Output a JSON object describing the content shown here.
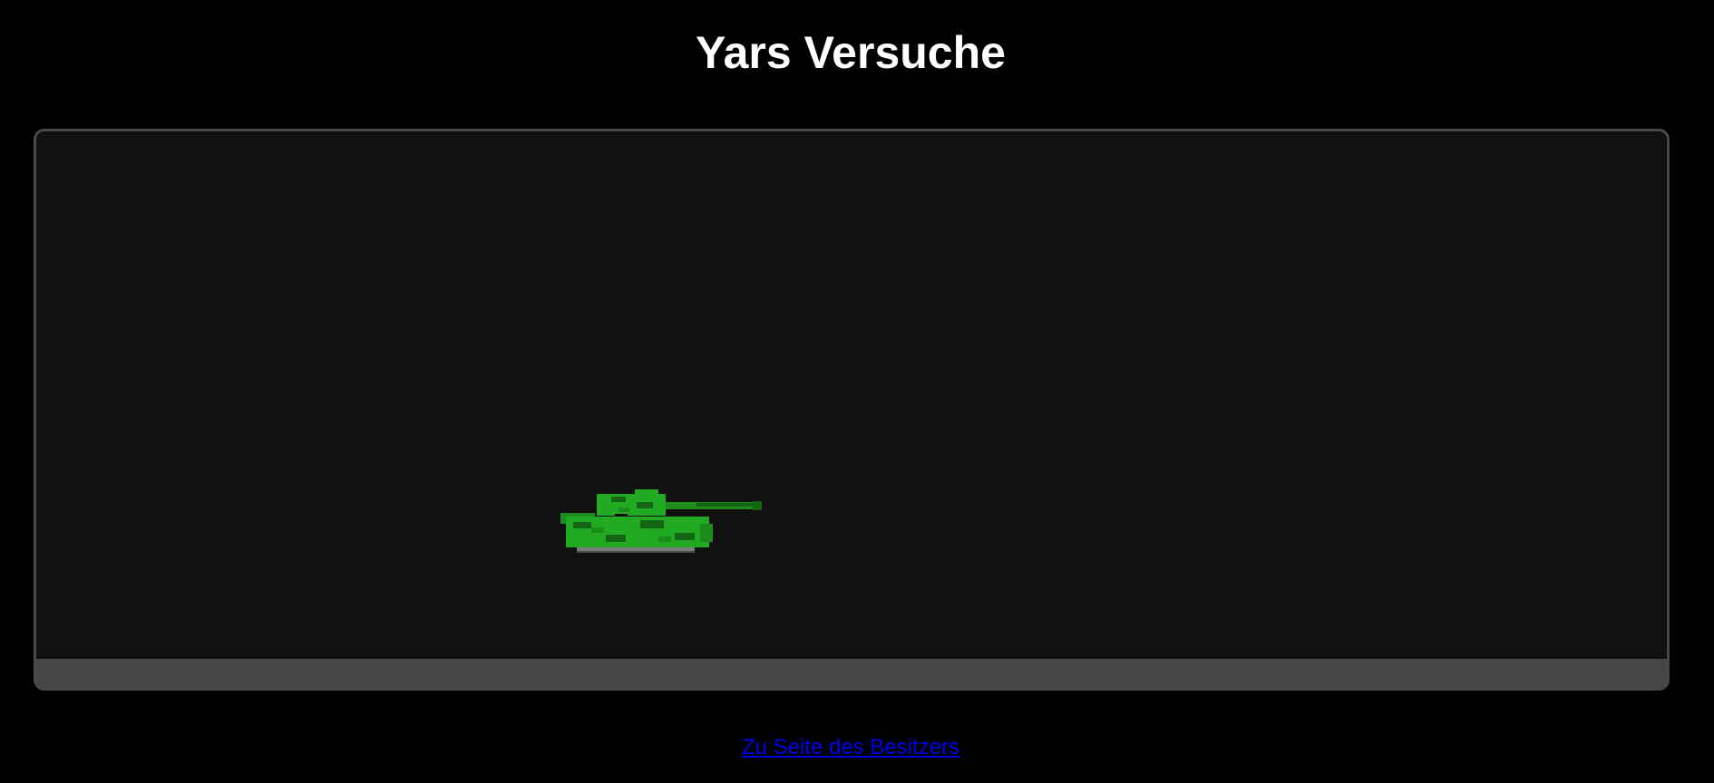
{
  "page": {
    "title": "Yars Versuche"
  },
  "game": {
    "sprite": "tank",
    "colors": {
      "background": "#111111",
      "frame_border": "#4a4a4a",
      "status_bar": "#474747",
      "tank_light": "#22aa22",
      "tank_dark": "#146614",
      "tank_mid": "#1c8c1c",
      "tank_track": "#7a7a7a"
    }
  },
  "footer": {
    "owner_link_label": "Zu Seite des Besitzers"
  }
}
